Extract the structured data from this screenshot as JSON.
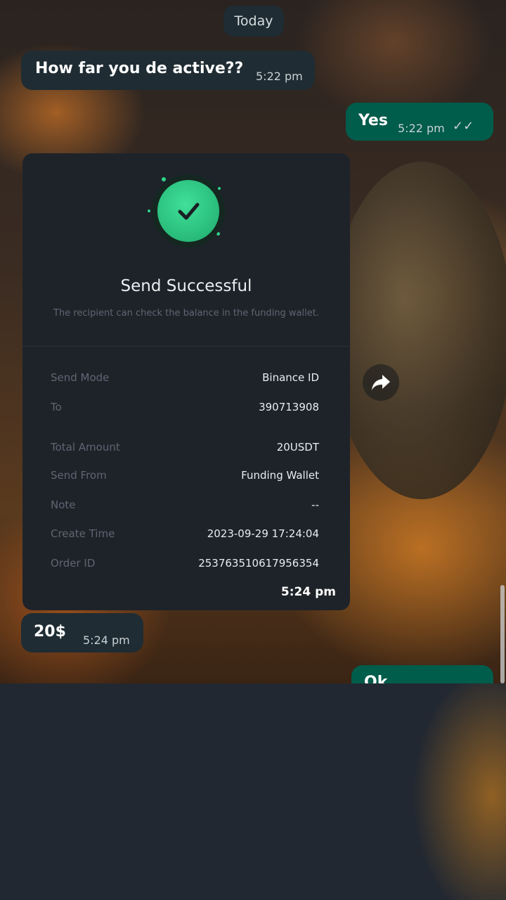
{
  "chat": {
    "date_separator": "Today",
    "messages": [
      {
        "direction": "incoming",
        "text": "How far you de active??",
        "time": "5:22 pm"
      },
      {
        "direction": "outgoing",
        "text": "Yes",
        "time": "5:22 pm",
        "status": "read"
      },
      {
        "direction": "incoming",
        "text": "20$",
        "time": "5:24 pm"
      },
      {
        "direction": "outgoing",
        "text": "Ok",
        "time": ""
      }
    ]
  },
  "receipt": {
    "title": "Send Successful",
    "subtitle": "The recipient can check the balance in the funding wallet.",
    "rows": [
      {
        "label": "Send Mode",
        "value": "Binance ID"
      },
      {
        "label": "To",
        "value": "390713908"
      },
      {
        "label": "Total Amount",
        "value": "20USDT"
      },
      {
        "label": "Send From",
        "value": "Funding Wallet"
      },
      {
        "label": "Note",
        "value": "--"
      },
      {
        "label": "Create Time",
        "value": "2023-09-29 17:24:04"
      },
      {
        "label": "Order ID",
        "value": "253763510617956354"
      }
    ],
    "time": "5:24 pm"
  },
  "icons": {
    "read_receipt": "double-check-icon",
    "forward": "forward-arrow-icon",
    "success": "check-circle-icon"
  },
  "colors": {
    "incoming_bubble": "#1f2c33",
    "outgoing_bubble": "#005c4b",
    "success_green": "#2ed68a",
    "card_background": "#1e2329"
  }
}
